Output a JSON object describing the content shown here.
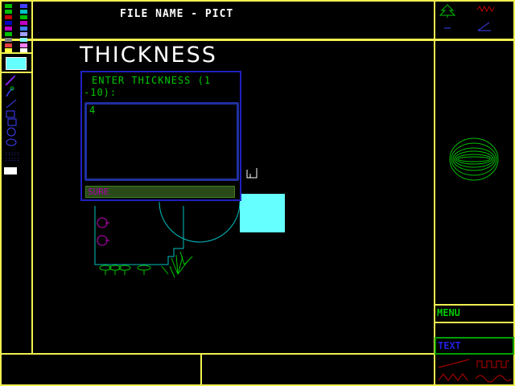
{
  "header": {
    "file_label": "FILE NAME - PICT"
  },
  "dialog": {
    "heading": "THICKNESS",
    "prompt_line1": "ENTER THICKNESS (1",
    "prompt_line2": "-10):",
    "input_value": "4",
    "confirm_label": "SURE"
  },
  "right_panel": {
    "menu_label": "MENU",
    "text_label": "TEXT"
  },
  "palette": {
    "left_col": [
      "#00c000",
      "#c00000",
      "#0000c0",
      "#c000c0",
      "#00c0c0",
      "#e0e000",
      "#808080",
      "#00c000",
      "#e04040",
      "#ffff40"
    ],
    "right_col": [
      "#4040ff",
      "#00c0c0",
      "#00c000",
      "#c000c0",
      "#4080ff",
      "#a000a0",
      "#a0a0ff",
      "#80ffff",
      "#ff80ff",
      "#ffffff"
    ],
    "current_color": "#66ffff"
  },
  "colors": {
    "border": "#f0f050",
    "accent": "#00c800",
    "dialog_border": "#2020c0"
  },
  "tools": [
    "pencil-icon",
    "brush-icon",
    "line-icon",
    "rectangle-icon",
    "circle-icon",
    "ellipse-icon",
    "spray-icon",
    "fill-icon",
    "eraser-icon"
  ]
}
